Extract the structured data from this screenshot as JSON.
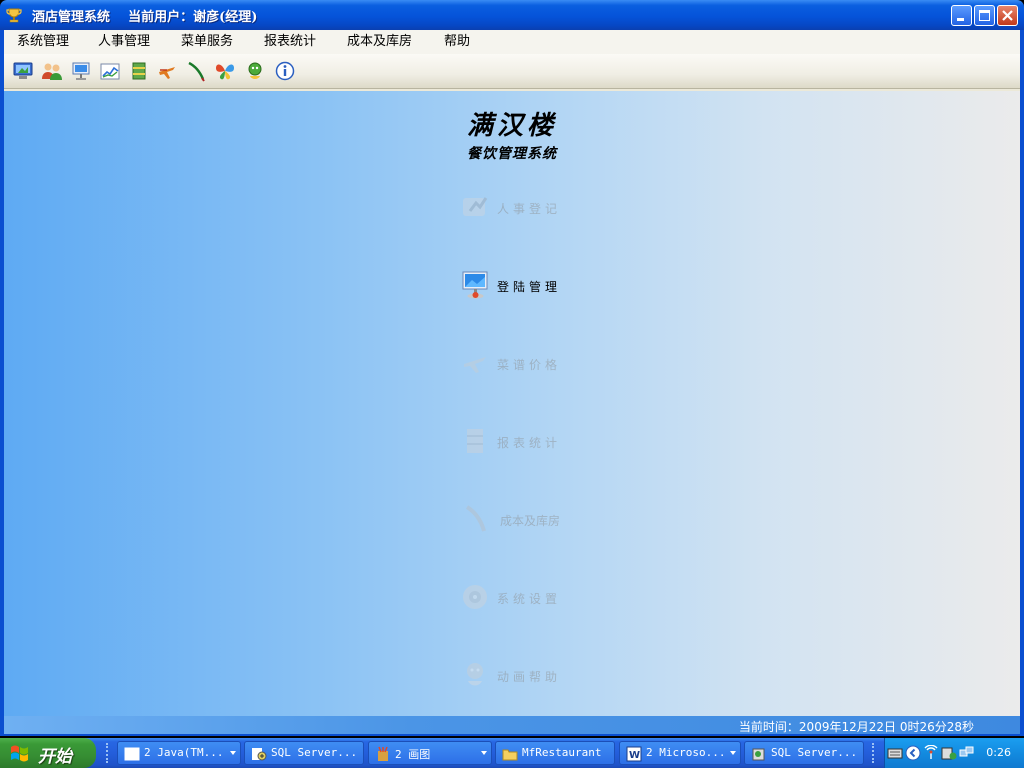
{
  "window": {
    "title": "酒店管理系统    当前用户：谢彦(经理)",
    "icon": "trophy-icon"
  },
  "menu": [
    "系统管理",
    "人事管理",
    "菜单服务",
    "报表统计",
    "成本及库房",
    "帮助"
  ],
  "toolbar_icons": [
    "computer-icon",
    "users-icon",
    "monitor-icon",
    "chart-icon",
    "book-icon",
    "plane-icon",
    "feather-icon",
    "butterfly-icon",
    "help-figure-icon",
    "info-icon"
  ],
  "header": {
    "title": "满汉楼",
    "subtitle": "餐饮管理系统"
  },
  "nav_items": [
    {
      "label": "人事登记",
      "icon": "register-icon",
      "state": "dimmed"
    },
    {
      "label": "登陆管理",
      "icon": "login-monitor-icon",
      "state": "active"
    },
    {
      "label": "菜谱价格",
      "icon": "menu-price-icon",
      "state": "dimmed"
    },
    {
      "label": "报表统计",
      "icon": "report-icon",
      "state": "dimmed"
    },
    {
      "label": "成本及库房",
      "icon": "feather-icon",
      "state": "dimmed"
    },
    {
      "label": "系统设置",
      "icon": "settings-icon",
      "state": "dimmed"
    },
    {
      "label": "动画帮助",
      "icon": "help-icon",
      "state": "dimmed"
    }
  ],
  "status": {
    "time_label": "当前时间：",
    "time_value": "2009年12月22日  0时26分28秒"
  },
  "taskbar": {
    "start_label": "开始",
    "tasks": [
      {
        "label": "2 Java(TM...",
        "icon": "window-icon",
        "grouped": true
      },
      {
        "label": "SQL Server...",
        "icon": "sql-icon",
        "grouped": false
      },
      {
        "label": "2 画图",
        "icon": "paint-icon",
        "grouped": true
      },
      {
        "label": "MfRestaurant",
        "icon": "folder-icon",
        "grouped": false
      },
      {
        "label": "2 Microso...",
        "icon": "word-icon",
        "grouped": true
      },
      {
        "label": "SQL Server...",
        "icon": "sql-manager-icon",
        "grouped": false
      }
    ],
    "clock": "0:26"
  },
  "colors": {
    "titlebar": "#0553d9",
    "taskbar": "#245edb",
    "start_green": "#3a9a37",
    "main_gradient_left": "#5eaaf3",
    "main_gradient_right": "#ebebeb"
  }
}
